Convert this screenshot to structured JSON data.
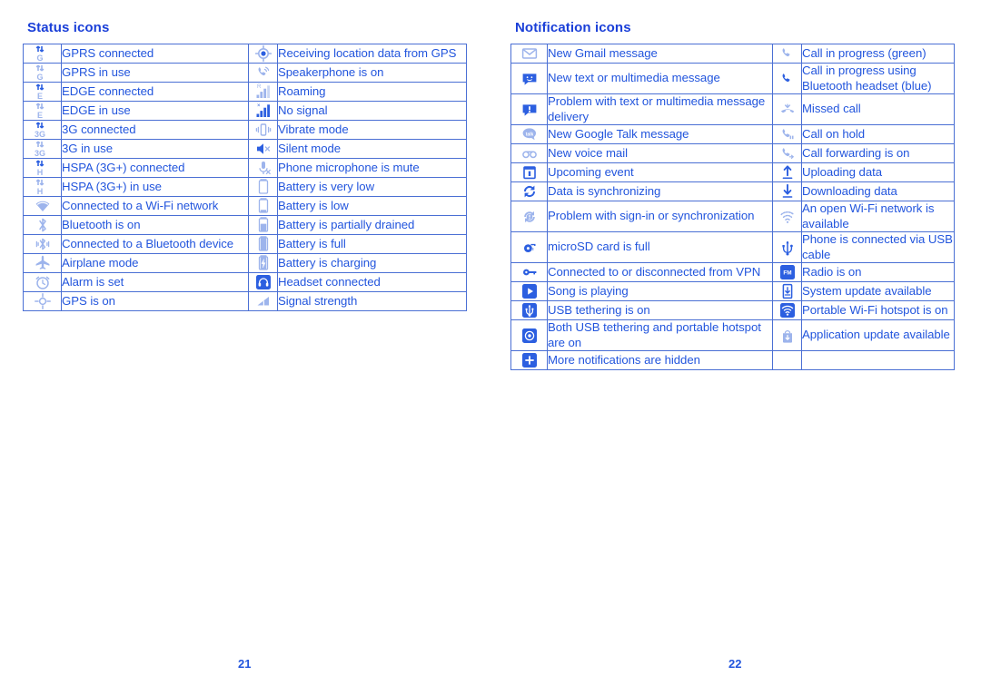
{
  "document": {
    "left_page_number": "21",
    "right_page_number": "22"
  },
  "colors": {
    "heading": "#1a3fd8",
    "text": "#2255dd",
    "border": "#4a6fd4",
    "icon_strong": "#2c5fe0",
    "icon_light": "#9db4ec"
  },
  "status_section": {
    "title": "Status icons",
    "rows": [
      {
        "left": {
          "icon": "gprs-connected-icon",
          "label": "GPRS connected"
        },
        "right": {
          "icon": "gps-location-icon",
          "label": "Receiving location data from GPS"
        }
      },
      {
        "left": {
          "icon": "gprs-in-use-icon",
          "label": "GPRS in use"
        },
        "right": {
          "icon": "speakerphone-icon",
          "label": "Speakerphone is on"
        }
      },
      {
        "left": {
          "icon": "edge-connected-icon",
          "label": "EDGE connected"
        },
        "right": {
          "icon": "roaming-icon",
          "label": "Roaming"
        }
      },
      {
        "left": {
          "icon": "edge-in-use-icon",
          "label": "EDGE in use"
        },
        "right": {
          "icon": "no-signal-icon",
          "label": "No signal"
        }
      },
      {
        "left": {
          "icon": "three-g-connected-icon",
          "label": "3G connected"
        },
        "right": {
          "icon": "vibrate-mode-icon",
          "label": "Vibrate mode"
        }
      },
      {
        "left": {
          "icon": "three-g-in-use-icon",
          "label": "3G in use"
        },
        "right": {
          "icon": "silent-mode-icon",
          "label": "Silent mode"
        }
      },
      {
        "left": {
          "icon": "hspa-connected-icon",
          "label": "HSPA (3G+) connected"
        },
        "right": {
          "icon": "microphone-mute-icon",
          "label": "Phone microphone is mute"
        }
      },
      {
        "left": {
          "icon": "hspa-in-use-icon",
          "label": "HSPA (3G+) in use"
        },
        "right": {
          "icon": "battery-very-low-icon",
          "label": "Battery is very low"
        }
      },
      {
        "left": {
          "icon": "wifi-connected-icon",
          "label": "Connected to a Wi-Fi network"
        },
        "right": {
          "icon": "battery-low-icon",
          "label": "Battery is low"
        }
      },
      {
        "left": {
          "icon": "bluetooth-on-icon",
          "label": "Bluetooth is on"
        },
        "right": {
          "icon": "battery-partial-icon",
          "label": "Battery is partially drained"
        }
      },
      {
        "left": {
          "icon": "bluetooth-connected-icon",
          "label": "Connected to a Bluetooth device"
        },
        "right": {
          "icon": "battery-full-icon",
          "label": "Battery is full"
        }
      },
      {
        "left": {
          "icon": "airplane-mode-icon",
          "label": "Airplane mode"
        },
        "right": {
          "icon": "battery-charging-icon",
          "label": "Battery is charging"
        }
      },
      {
        "left": {
          "icon": "alarm-icon",
          "label": "Alarm is set"
        },
        "right": {
          "icon": "headset-icon",
          "label": "Headset connected"
        }
      },
      {
        "left": {
          "icon": "gps-on-icon",
          "label": "GPS is on"
        },
        "right": {
          "icon": "signal-strength-icon",
          "label": "Signal strength"
        }
      }
    ]
  },
  "notification_section": {
    "title": "Notification icons",
    "rows": [
      {
        "left": {
          "icon": "gmail-icon",
          "label": "New Gmail message"
        },
        "right": {
          "icon": "call-in-progress-icon",
          "label": "Call in progress (green)"
        }
      },
      {
        "left": {
          "icon": "sms-message-icon",
          "label": "New text or multimedia message"
        },
        "right": {
          "icon": "call-bluetooth-icon",
          "label": "Call in progress using Bluetooth headset (blue)"
        }
      },
      {
        "left": {
          "icon": "message-problem-icon",
          "label": "Problem with text or multimedia message delivery"
        },
        "right": {
          "icon": "missed-call-icon",
          "label": "Missed call"
        }
      },
      {
        "left": {
          "icon": "google-talk-icon",
          "label": "New Google Talk message"
        },
        "right": {
          "icon": "call-on-hold-icon",
          "label": "Call on hold"
        }
      },
      {
        "left": {
          "icon": "voicemail-icon",
          "label": "New voice mail"
        },
        "right": {
          "icon": "call-forwarding-icon",
          "label": "Call forwarding is on"
        }
      },
      {
        "left": {
          "icon": "calendar-event-icon",
          "label": "Upcoming event"
        },
        "right": {
          "icon": "upload-icon",
          "label": "Uploading data"
        }
      },
      {
        "left": {
          "icon": "sync-icon",
          "label": "Data is synchronizing"
        },
        "right": {
          "icon": "download-icon",
          "label": "Downloading data"
        }
      },
      {
        "left": {
          "icon": "sync-problem-icon",
          "label": "Problem with sign-in or synchronization"
        },
        "right": {
          "icon": "open-wifi-icon",
          "label": "An open Wi-Fi network is available"
        }
      },
      {
        "left": {
          "icon": "microsd-full-icon",
          "label": "microSD card is full"
        },
        "right": {
          "icon": "usb-icon",
          "label": "Phone is connected via USB cable"
        }
      },
      {
        "left": {
          "icon": "vpn-key-icon",
          "label": "Connected to or disconnected from VPN"
        },
        "right": {
          "icon": "radio-fm-icon",
          "label": "Radio is on"
        }
      },
      {
        "left": {
          "icon": "music-play-icon",
          "label": "Song is playing"
        },
        "right": {
          "icon": "system-update-icon",
          "label": "System update available"
        }
      },
      {
        "left": {
          "icon": "usb-tethering-icon",
          "label": "USB tethering is on"
        },
        "right": {
          "icon": "portable-hotspot-icon",
          "label": "Portable Wi-Fi hotspot is on"
        }
      },
      {
        "left": {
          "icon": "usb-and-hotspot-icon",
          "label": "Both USB tethering and portable hotspot are on"
        },
        "right": {
          "icon": "app-update-icon",
          "label": "Application update available"
        }
      },
      {
        "left": {
          "icon": "more-notifications-icon",
          "label": "More notifications are hidden"
        },
        "right": {
          "icon": "",
          "label": ""
        }
      }
    ]
  }
}
